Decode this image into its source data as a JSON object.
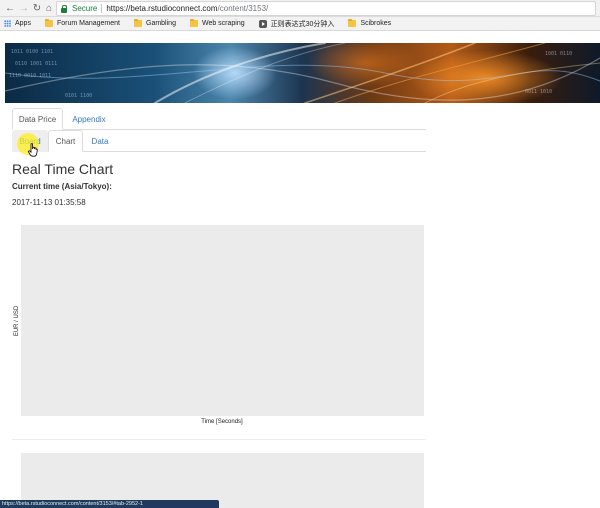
{
  "browser": {
    "secure_label": "Secure",
    "url_host": "https://beta.rstudioconnect.com",
    "url_path": "/content/3153/",
    "bookmarks": [
      "Apps",
      "Forum Management",
      "Gambling",
      "Web scraping",
      "正则表达式30分钟入",
      "Scibrokes"
    ]
  },
  "tabs": {
    "top": [
      "Data Price",
      "Appendix"
    ],
    "sub": [
      "Board",
      "Chart",
      "Data"
    ]
  },
  "content": {
    "title": "Real Time Chart",
    "time_label": "Current time (Asia/Tokyo):",
    "time_value": "2017-11-13 01:35:58"
  },
  "chart_data": {
    "type": "line",
    "series": [],
    "xlabel": "Time [Seconds]",
    "ylabel": "EUR / USD",
    "grid": false
  },
  "status": {
    "url": "https://beta.rstudioconnect.com/content/3153/#tab-2952-1"
  },
  "colors": {
    "link": "#337ab7",
    "secure": "#188038",
    "plot_bg": "#ebebeb",
    "cursor_highlight": "#ffee1e"
  }
}
